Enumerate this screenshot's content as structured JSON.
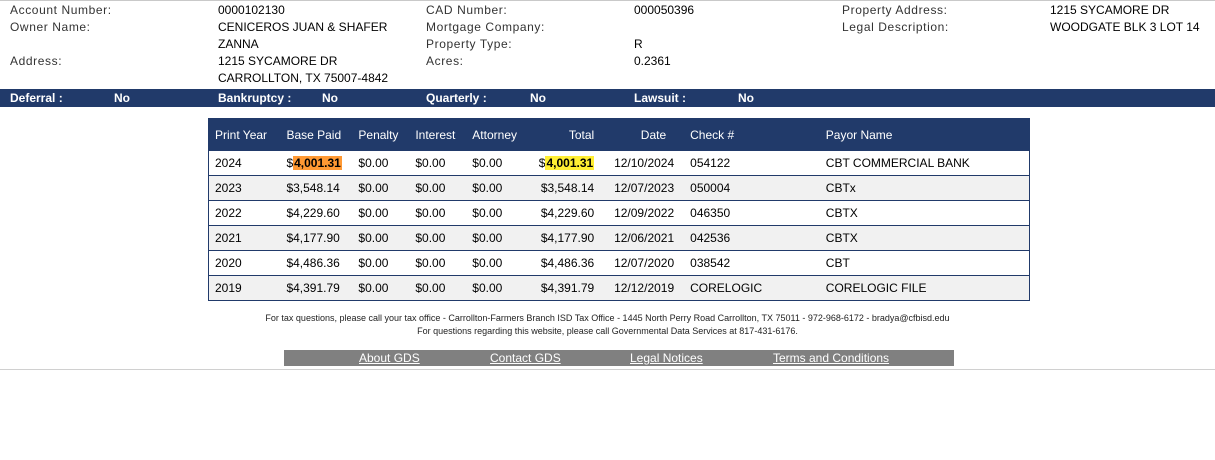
{
  "account": {
    "account_number_label": "Account Number:",
    "account_number": "0000102130",
    "owner_name_label": "Owner Name:",
    "owner_name_line1": "CENICEROS JUAN & SHAFER",
    "owner_name_line2": "ZANNA",
    "address_label": "Address:",
    "address_line1": "1215 SYCAMORE DR",
    "address_line2": "CARROLLTON, TX 75007-4842",
    "cad_number_label": "CAD Number:",
    "cad_number": "000050396",
    "mortgage_company_label": "Mortgage Company:",
    "mortgage_company": "",
    "property_type_label": "Property Type:",
    "property_type": "R",
    "acres_label": "Acres:",
    "acres": "0.2361",
    "property_address_label": "Property Address:",
    "property_address": "1215 SYCAMORE DR",
    "legal_description_label": "Legal Description:",
    "legal_description": "WOODGATE BLK 3 LOT 14"
  },
  "flags": {
    "deferral_label": "Deferral :",
    "deferral": "No",
    "bankruptcy_label": "Bankruptcy :",
    "bankruptcy": "No",
    "quarterly_label": "Quarterly :",
    "quarterly": "No",
    "lawsuit_label": "Lawsuit :",
    "lawsuit": "No"
  },
  "history": {
    "headers": [
      "Print Year",
      "Base Paid",
      "Penalty",
      "Interest",
      "Attorney",
      "Total",
      "Date",
      "Check #",
      "Payor Name"
    ],
    "rows": [
      {
        "year": "2024",
        "base_prefix": "$",
        "base_amount": "4,001.31",
        "penalty": "$0.00",
        "interest": "$0.00",
        "attorney": "$0.00",
        "total_prefix": "$",
        "total_amount": "4,001.31",
        "date": "12/10/2024",
        "check": "054122",
        "payor": "CBT COMMERCIAL BANK"
      },
      {
        "year": "2023",
        "base_paid": "$3,548.14",
        "penalty": "$0.00",
        "interest": "$0.00",
        "attorney": "$0.00",
        "total": "$3,548.14",
        "date": "12/07/2023",
        "check": "050004",
        "payor": "CBTx"
      },
      {
        "year": "2022",
        "base_paid": "$4,229.60",
        "penalty": "$0.00",
        "interest": "$0.00",
        "attorney": "$0.00",
        "total": "$4,229.60",
        "date": "12/09/2022",
        "check": "046350",
        "payor": "CBTX"
      },
      {
        "year": "2021",
        "base_paid": "$4,177.90",
        "penalty": "$0.00",
        "interest": "$0.00",
        "attorney": "$0.00",
        "total": "$4,177.90",
        "date": "12/06/2021",
        "check": "042536",
        "payor": "CBTX"
      },
      {
        "year": "2020",
        "base_paid": "$4,486.36",
        "penalty": "$0.00",
        "interest": "$0.00",
        "attorney": "$0.00",
        "total": "$4,486.36",
        "date": "12/07/2020",
        "check": "038542",
        "payor": "CBT"
      },
      {
        "year": "2019",
        "base_paid": "$4,391.79",
        "penalty": "$0.00",
        "interest": "$0.00",
        "attorney": "$0.00",
        "total": "$4,391.79",
        "date": "12/12/2019",
        "check": "CORELOGIC",
        "payor": "CORELOGIC FILE"
      }
    ]
  },
  "footer": {
    "line1": "For tax questions, please call your tax office - Carrollton-Farmers Branch ISD Tax Office - 1445 North Perry Road Carrollton, TX 75011 - 972-968-6172 - bradya@cfbisd.edu",
    "line2": "For questions regarding this website, please call Governmental Data Services at 817-431-6176.",
    "links": [
      "About GDS",
      "Contact GDS",
      "Legal Notices",
      "Terms and Conditions"
    ]
  },
  "colors": {
    "header_navy": "#213a6a",
    "highlight_orange": "#ff9933",
    "highlight_yellow": "#ffee33",
    "link_bar_gray": "#808080"
  }
}
